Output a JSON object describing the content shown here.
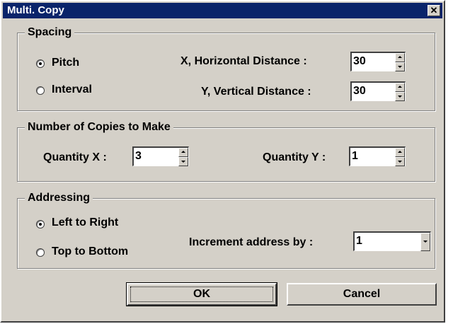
{
  "window": {
    "title": "Multi. Copy",
    "close_glyph": "✕"
  },
  "spacing": {
    "legend": "Spacing",
    "options": [
      {
        "label": "Pitch",
        "selected": true
      },
      {
        "label": "Interval",
        "selected": false
      }
    ],
    "x_label": "X, Horizontal Distance :",
    "x_value": "30",
    "y_label": "Y, Vertical Distance :",
    "y_value": "30"
  },
  "copies": {
    "legend": "Number of Copies to Make",
    "qx_label": "Quantity X  :",
    "qx_value": "3",
    "qy_label": "Quantity Y :",
    "qy_value": "1"
  },
  "addressing": {
    "legend": "Addressing",
    "options": [
      {
        "label": "Left to Right",
        "selected": true
      },
      {
        "label": "Top to Bottom",
        "selected": false
      }
    ],
    "increment_label": "Increment address by :",
    "increment_value": "1"
  },
  "buttons": {
    "ok": "OK",
    "cancel": "Cancel"
  },
  "icons": {
    "close": "close-icon",
    "spin_up": "arrow-up-icon",
    "spin_down": "arrow-down-icon",
    "dropdown": "chevron-down-icon"
  },
  "colors": {
    "titlebar": "#0a246a",
    "face": "#d4d0c8"
  }
}
